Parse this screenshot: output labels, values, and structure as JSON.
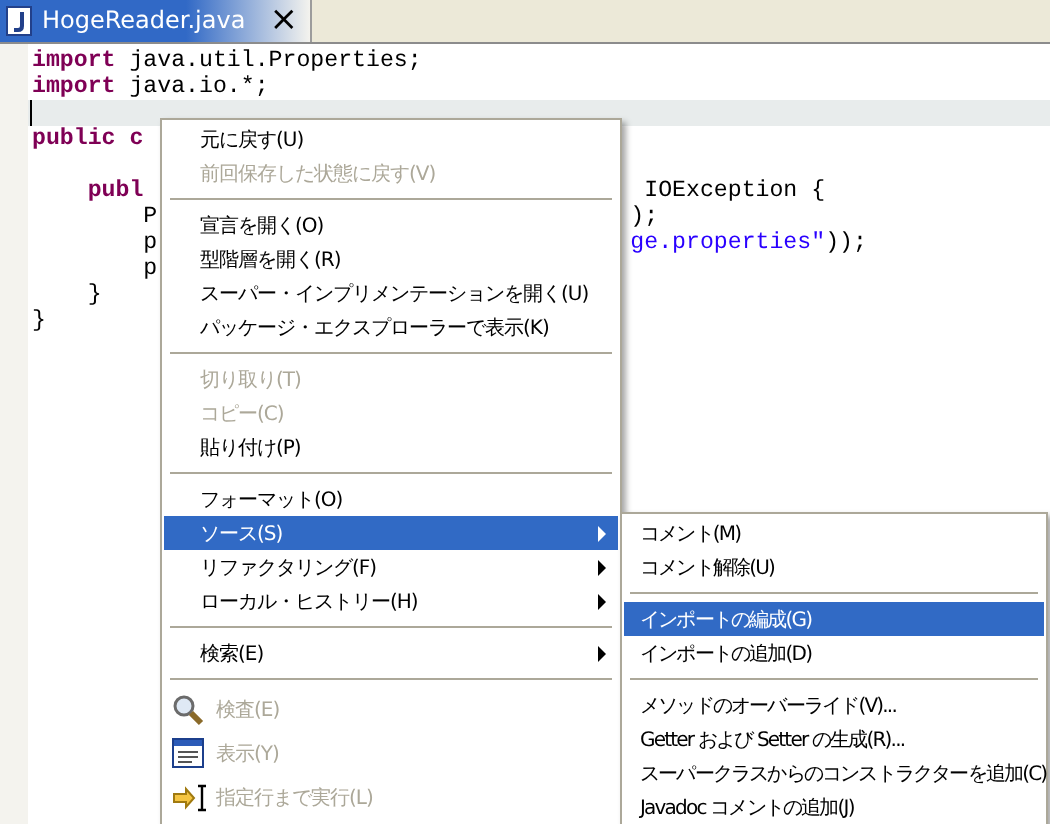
{
  "tab": {
    "title": "HogeReader.java",
    "close": "×",
    "selected": true
  },
  "code_lines": [
    {
      "kind": "code",
      "segments": [
        {
          "text": "import",
          "kind": "keyword"
        },
        {
          "text": " java.util.Properties;",
          "kind": "plain"
        }
      ]
    },
    {
      "kind": "code",
      "segments": [
        {
          "text": "import",
          "kind": "keyword"
        },
        {
          "text": " java.io.*;",
          "kind": "plain"
        }
      ]
    },
    {
      "kind": "blank",
      "current": true
    },
    {
      "kind": "code",
      "segments": [
        {
          "text": "public c",
          "kind": "keyword"
        }
      ]
    },
    {
      "kind": "blank"
    },
    {
      "kind": "code",
      "segments": [
        {
          "text": "    publ",
          "kind": "keyword"
        }
      ],
      "right": [
        {
          "text": " IOException {",
          "kind": "plain"
        }
      ]
    },
    {
      "kind": "code",
      "segments": [
        {
          "text": "        P",
          "kind": "plain"
        }
      ],
      "right": [
        {
          "text": ");",
          "kind": "plain"
        }
      ]
    },
    {
      "kind": "code",
      "segments": [
        {
          "text": "        p",
          "kind": "plain"
        }
      ],
      "right": [
        {
          "text": "ge.properties\"",
          "kind": "string"
        },
        {
          "text": "));",
          "kind": "plain"
        }
      ]
    },
    {
      "kind": "code",
      "segments": [
        {
          "text": "        p",
          "kind": "plain"
        }
      ]
    },
    {
      "kind": "code",
      "segments": [
        {
          "text": "    }",
          "kind": "plain"
        }
      ]
    },
    {
      "kind": "code",
      "segments": [
        {
          "text": "}",
          "kind": "plain"
        }
      ]
    }
  ],
  "context_menu": {
    "items": [
      {
        "kind": "item",
        "label": "元に戻す(U)",
        "disabled": false,
        "selected": false
      },
      {
        "kind": "item",
        "label": "前回保存した状態に戻す(V)",
        "disabled": true,
        "selected": false
      },
      {
        "kind": "separator"
      },
      {
        "kind": "item",
        "label": "宣言を開く(O)",
        "disabled": false,
        "selected": false
      },
      {
        "kind": "item",
        "label": "型階層を開く(R)",
        "disabled": false,
        "selected": false
      },
      {
        "kind": "item",
        "label": "スーパー・インプリメンテーションを開く(U)",
        "disabled": false,
        "selected": false
      },
      {
        "kind": "item",
        "label": "パッケージ・エクスプローラーで表示(K)",
        "disabled": false,
        "selected": false
      },
      {
        "kind": "separator"
      },
      {
        "kind": "item",
        "label": "切り取り(T)",
        "disabled": true,
        "selected": false
      },
      {
        "kind": "item",
        "label": "コピー(C)",
        "disabled": true,
        "selected": false
      },
      {
        "kind": "item",
        "label": "貼り付け(P)",
        "disabled": false,
        "selected": false
      },
      {
        "kind": "separator"
      },
      {
        "kind": "item",
        "label": "フォーマット(O)",
        "disabled": false,
        "selected": false
      },
      {
        "kind": "submenu",
        "label": "ソース(S)",
        "disabled": false,
        "selected": true,
        "children": [
          {
            "kind": "item",
            "label": "コメント(M)",
            "disabled": false,
            "selected": false
          },
          {
            "kind": "item",
            "label": "コメント解除(U)",
            "disabled": false,
            "selected": false
          },
          {
            "kind": "separator"
          },
          {
            "kind": "item",
            "label": "インポートの編成(G)",
            "disabled": false,
            "selected": true
          },
          {
            "kind": "item",
            "label": "インポートの追加(D)",
            "disabled": false,
            "selected": false
          },
          {
            "kind": "separator"
          },
          {
            "kind": "item",
            "label": "メソッドのオーバーライド(V)...",
            "disabled": false,
            "selected": false
          },
          {
            "kind": "item",
            "label": "Getter および Setter の生成(R)...",
            "disabled": false,
            "selected": false
          },
          {
            "kind": "item",
            "label": "スーパークラスからのコンストラクターを追加(C)",
            "disabled": false,
            "selected": false
          },
          {
            "kind": "item",
            "label": "Javadoc コメントの追加(J)",
            "disabled": false,
            "selected": false
          }
        ]
      },
      {
        "kind": "submenu",
        "label": "リファクタリング(F)",
        "disabled": false,
        "selected": false
      },
      {
        "kind": "submenu",
        "label": "ローカル・ヒストリー(H)",
        "disabled": false,
        "selected": false
      },
      {
        "kind": "separator"
      },
      {
        "kind": "submenu",
        "label": "検索(E)",
        "disabled": false,
        "selected": false
      },
      {
        "kind": "separator"
      },
      {
        "kind": "inspect",
        "label": "検査(E)",
        "disabled": true,
        "selected": false
      },
      {
        "kind": "display",
        "label": "表示(Y)",
        "disabled": true,
        "selected": false
      },
      {
        "kind": "run-to-line",
        "label": "指定行まで実行(L)",
        "disabled": true,
        "selected": false
      }
    ]
  }
}
